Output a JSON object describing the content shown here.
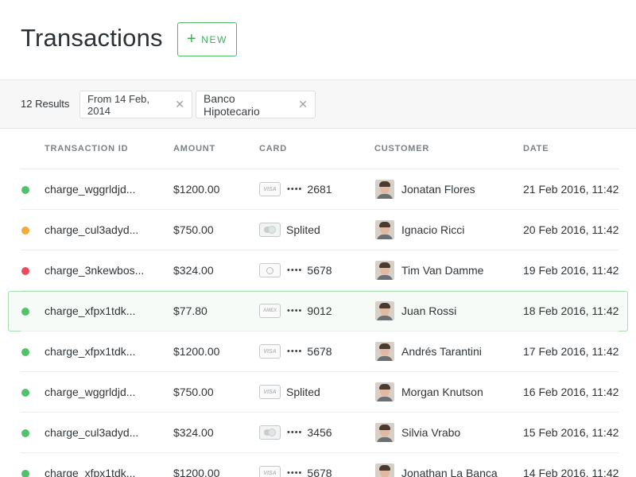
{
  "header": {
    "title": "Transactions",
    "new_label": "NEW"
  },
  "filters": {
    "results": "12 Results",
    "chips": [
      {
        "label": "From 14 Feb, 2014"
      },
      {
        "label": "Banco Hipotecario"
      }
    ]
  },
  "columns": [
    "TRANSACTION ID",
    "AMOUNT",
    "CARD",
    "CUSTOMER",
    "DATE"
  ],
  "rows": [
    {
      "status_color": "#52c26a",
      "id": "charge_wggrldjd...",
      "amount": "$1200.00",
      "card_type": "visa",
      "card_brand": "VISA",
      "card_mask": "••••",
      "card_last4": "2681",
      "card_label": "",
      "customer": "Jonatan Flores",
      "date": "21 Feb 2016, 11:42"
    },
    {
      "status_color": "#f5a93b",
      "id": "charge_cul3adyd...",
      "amount": "$750.00",
      "card_type": "split",
      "card_brand": "",
      "card_mask": "",
      "card_last4": "",
      "card_label": "Splited",
      "customer": "Ignacio Ricci",
      "date": "20 Feb 2016, 11:42"
    },
    {
      "status_color": "#ee4a5d",
      "id": "charge_3nkewbos...",
      "amount": "$324.00",
      "card_type": "diners",
      "card_brand": "",
      "card_mask": "••••",
      "card_last4": "5678",
      "card_label": "",
      "customer": "Tim Van Damme",
      "date": "19 Feb 2016, 11:42"
    },
    {
      "status_color": "#52c26a",
      "id": "charge_xfpx1tdk...",
      "amount": "$77.80",
      "card_type": "amex",
      "card_brand": "AMEX",
      "card_mask": "••••",
      "card_last4": "9012",
      "card_label": "",
      "customer": "Juan Rossi",
      "date": "18 Feb 2016, 11:42",
      "selected": true
    },
    {
      "status_color": "#52c26a",
      "id": "charge_xfpx1tdk...",
      "amount": "$1200.00",
      "card_type": "visa",
      "card_brand": "VISA",
      "card_mask": "••••",
      "card_last4": "5678",
      "card_label": "",
      "customer": "Andrés Tarantini",
      "date": "17 Feb 2016, 11:42"
    },
    {
      "status_color": "#52c26a",
      "id": "charge_wggrldjd...",
      "amount": "$750.00",
      "card_type": "visa",
      "card_brand": "VISA",
      "card_mask": "",
      "card_last4": "",
      "card_label": "Splited",
      "customer": "Morgan Knutson",
      "date": "16 Feb 2016, 11:42"
    },
    {
      "status_color": "#52c26a",
      "id": "charge_cul3adyd...",
      "amount": "$324.00",
      "card_type": "split",
      "card_brand": "",
      "card_mask": "••••",
      "card_last4": "3456",
      "card_label": "",
      "customer": "Silvia Vrabo",
      "date": "15 Feb 2016, 11:42"
    },
    {
      "status_color": "#52c26a",
      "id": "charge_xfpx1tdk...",
      "amount": "$1200.00",
      "card_type": "visa",
      "card_brand": "VISA",
      "card_mask": "••••",
      "card_last4": "5678",
      "card_label": "",
      "customer": "Jonathan La Banca",
      "date": "14 Feb 2016, 11:42"
    }
  ],
  "accent_color": "#52b866"
}
